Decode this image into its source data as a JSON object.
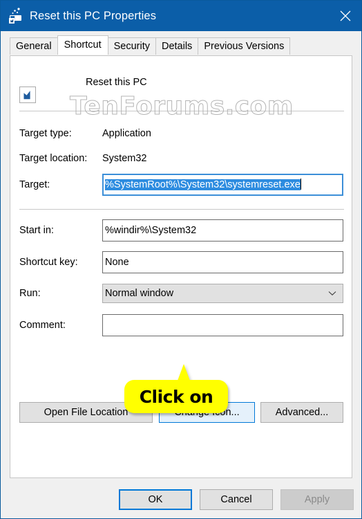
{
  "window": {
    "title": "Reset this PC Properties",
    "title_icon": "reset-pc-shortcut-icon",
    "close_icon": "close-icon",
    "border_color": "#0a5a9c",
    "titlebar_color": "#0b5ea8"
  },
  "tabs": [
    {
      "label": "General",
      "active": false
    },
    {
      "label": "Shortcut",
      "active": true
    },
    {
      "label": "Security",
      "active": false
    },
    {
      "label": "Details",
      "active": false
    },
    {
      "label": "Previous Versions",
      "active": false
    }
  ],
  "shortcut_tab": {
    "item_name": "Reset this PC",
    "item_icon": "shortcut-arrow-icon",
    "watermark": "TenForums.com",
    "fields": [
      {
        "label": "Target type:",
        "value": "Application",
        "kind": "static"
      },
      {
        "label": "Target location:",
        "value": "System32",
        "kind": "static"
      },
      {
        "label": "Target:",
        "value": "%SystemRoot%\\System32\\systemreset.exe",
        "kind": "text",
        "focused": true,
        "selected": true
      },
      {
        "label": "Start in:",
        "value": "%windir%\\System32",
        "kind": "text"
      },
      {
        "label": "Shortcut key:",
        "value": "None",
        "kind": "text"
      },
      {
        "label": "Run:",
        "value": "Normal window",
        "kind": "combo",
        "chevron_icon": "chevron-down-icon"
      },
      {
        "label": "Comment:",
        "value": "",
        "kind": "text"
      }
    ],
    "buttons": {
      "open_file_location": "Open File Location",
      "change_icon": "Change Icon...",
      "advanced": "Advanced..."
    }
  },
  "callout": {
    "text": "Click on",
    "background": "#ffff00",
    "text_color": "#000000"
  },
  "footer": {
    "ok": "OK",
    "cancel": "Cancel",
    "apply": "Apply",
    "apply_disabled": true
  }
}
